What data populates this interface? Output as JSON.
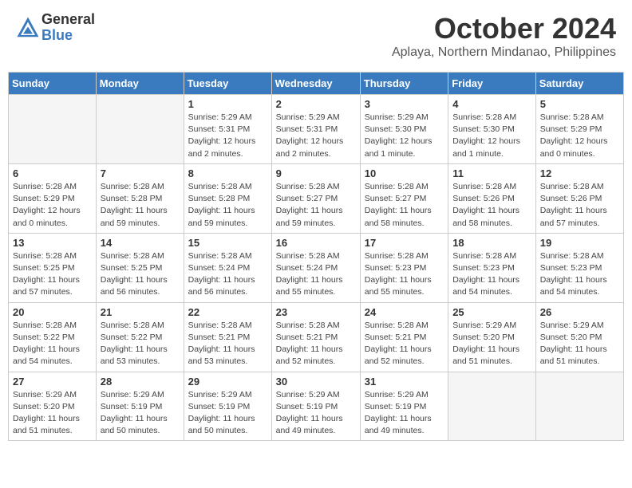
{
  "header": {
    "logo_general": "General",
    "logo_blue": "Blue",
    "month_title": "October 2024",
    "location": "Aplaya, Northern Mindanao, Philippines"
  },
  "days_of_week": [
    "Sunday",
    "Monday",
    "Tuesday",
    "Wednesday",
    "Thursday",
    "Friday",
    "Saturday"
  ],
  "weeks": [
    [
      {
        "day": "",
        "detail": ""
      },
      {
        "day": "",
        "detail": ""
      },
      {
        "day": "1",
        "detail": "Sunrise: 5:29 AM\nSunset: 5:31 PM\nDaylight: 12 hours and 2 minutes."
      },
      {
        "day": "2",
        "detail": "Sunrise: 5:29 AM\nSunset: 5:31 PM\nDaylight: 12 hours and 2 minutes."
      },
      {
        "day": "3",
        "detail": "Sunrise: 5:29 AM\nSunset: 5:30 PM\nDaylight: 12 hours and 1 minute."
      },
      {
        "day": "4",
        "detail": "Sunrise: 5:28 AM\nSunset: 5:30 PM\nDaylight: 12 hours and 1 minute."
      },
      {
        "day": "5",
        "detail": "Sunrise: 5:28 AM\nSunset: 5:29 PM\nDaylight: 12 hours and 0 minutes."
      }
    ],
    [
      {
        "day": "6",
        "detail": "Sunrise: 5:28 AM\nSunset: 5:29 PM\nDaylight: 12 hours and 0 minutes."
      },
      {
        "day": "7",
        "detail": "Sunrise: 5:28 AM\nSunset: 5:28 PM\nDaylight: 11 hours and 59 minutes."
      },
      {
        "day": "8",
        "detail": "Sunrise: 5:28 AM\nSunset: 5:28 PM\nDaylight: 11 hours and 59 minutes."
      },
      {
        "day": "9",
        "detail": "Sunrise: 5:28 AM\nSunset: 5:27 PM\nDaylight: 11 hours and 59 minutes."
      },
      {
        "day": "10",
        "detail": "Sunrise: 5:28 AM\nSunset: 5:27 PM\nDaylight: 11 hours and 58 minutes."
      },
      {
        "day": "11",
        "detail": "Sunrise: 5:28 AM\nSunset: 5:26 PM\nDaylight: 11 hours and 58 minutes."
      },
      {
        "day": "12",
        "detail": "Sunrise: 5:28 AM\nSunset: 5:26 PM\nDaylight: 11 hours and 57 minutes."
      }
    ],
    [
      {
        "day": "13",
        "detail": "Sunrise: 5:28 AM\nSunset: 5:25 PM\nDaylight: 11 hours and 57 minutes."
      },
      {
        "day": "14",
        "detail": "Sunrise: 5:28 AM\nSunset: 5:25 PM\nDaylight: 11 hours and 56 minutes."
      },
      {
        "day": "15",
        "detail": "Sunrise: 5:28 AM\nSunset: 5:24 PM\nDaylight: 11 hours and 56 minutes."
      },
      {
        "day": "16",
        "detail": "Sunrise: 5:28 AM\nSunset: 5:24 PM\nDaylight: 11 hours and 55 minutes."
      },
      {
        "day": "17",
        "detail": "Sunrise: 5:28 AM\nSunset: 5:23 PM\nDaylight: 11 hours and 55 minutes."
      },
      {
        "day": "18",
        "detail": "Sunrise: 5:28 AM\nSunset: 5:23 PM\nDaylight: 11 hours and 54 minutes."
      },
      {
        "day": "19",
        "detail": "Sunrise: 5:28 AM\nSunset: 5:23 PM\nDaylight: 11 hours and 54 minutes."
      }
    ],
    [
      {
        "day": "20",
        "detail": "Sunrise: 5:28 AM\nSunset: 5:22 PM\nDaylight: 11 hours and 54 minutes."
      },
      {
        "day": "21",
        "detail": "Sunrise: 5:28 AM\nSunset: 5:22 PM\nDaylight: 11 hours and 53 minutes."
      },
      {
        "day": "22",
        "detail": "Sunrise: 5:28 AM\nSunset: 5:21 PM\nDaylight: 11 hours and 53 minutes."
      },
      {
        "day": "23",
        "detail": "Sunrise: 5:28 AM\nSunset: 5:21 PM\nDaylight: 11 hours and 52 minutes."
      },
      {
        "day": "24",
        "detail": "Sunrise: 5:28 AM\nSunset: 5:21 PM\nDaylight: 11 hours and 52 minutes."
      },
      {
        "day": "25",
        "detail": "Sunrise: 5:29 AM\nSunset: 5:20 PM\nDaylight: 11 hours and 51 minutes."
      },
      {
        "day": "26",
        "detail": "Sunrise: 5:29 AM\nSunset: 5:20 PM\nDaylight: 11 hours and 51 minutes."
      }
    ],
    [
      {
        "day": "27",
        "detail": "Sunrise: 5:29 AM\nSunset: 5:20 PM\nDaylight: 11 hours and 51 minutes."
      },
      {
        "day": "28",
        "detail": "Sunrise: 5:29 AM\nSunset: 5:19 PM\nDaylight: 11 hours and 50 minutes."
      },
      {
        "day": "29",
        "detail": "Sunrise: 5:29 AM\nSunset: 5:19 PM\nDaylight: 11 hours and 50 minutes."
      },
      {
        "day": "30",
        "detail": "Sunrise: 5:29 AM\nSunset: 5:19 PM\nDaylight: 11 hours and 49 minutes."
      },
      {
        "day": "31",
        "detail": "Sunrise: 5:29 AM\nSunset: 5:19 PM\nDaylight: 11 hours and 49 minutes."
      },
      {
        "day": "",
        "detail": ""
      },
      {
        "day": "",
        "detail": ""
      }
    ]
  ]
}
